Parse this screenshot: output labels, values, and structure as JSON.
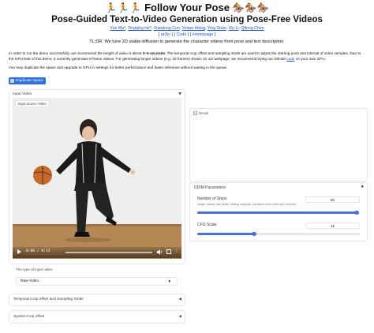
{
  "header": {
    "title_prefix_icons": "🏃🏃🏃",
    "title": "Follow Your Pose",
    "title_suffix_icons": "🏇🏇🏇",
    "subtitle": "Pose-Guided Text-to-Video Generation using Pose-Free Videos",
    "authors": [
      "Yue Ma*",
      "Yingqing He*",
      "Xiaodong Cun",
      "Xintao Wang",
      "Ying Shan",
      "Xiu Li",
      "Qifeng Chen"
    ],
    "links": {
      "open": "[ ",
      "arxiv": "arXiv",
      "sep1": " ] [ ",
      "code": "Code",
      "sep2": " ] [ ",
      "homepage": "Homepage",
      "close": " ]"
    },
    "tldr": "TL;DR: We tune 2D stable-diffusion to generate the character videos from pose and text description."
  },
  "notes": {
    "line1_a": "In order to run the demo successfully, we recommend the length of video is about ",
    "line1_b": "3~5 seconds",
    "line1_c": ". The temporal crop offset and sampling stride are used to adjust the starting point and interval of video samples. Due to",
    "line2_a": "the GPU limit of this demo, it currently generates 8-frame videos. For generating longer videos (e.g. 32 frames) shown on our webpage, we recommend trying our GitHub ",
    "line2_link": "code",
    "line2_b": " on your own GPU.",
    "line3": "You may duplicate the space and upgrade to GPU in settings for better performance and faster inference without waiting in the queue."
  },
  "duplicate_button": "Duplicate Space",
  "input_panel": {
    "title": "Input Video",
    "source_label": "Input Source Video",
    "time": "0:00 / 0:13",
    "type_label": "The type of input video",
    "type_value": "Raw Video",
    "accordions": [
      "Temporal Crop offset and Sampling Stride",
      "Spatial Crop offset"
    ]
  },
  "result_panel": {
    "title": "Result"
  },
  "ddim": {
    "title": "DDIM Parameters",
    "steps_label": "Number of Steps",
    "steps_info": "longer values has better editing capacity, but takes more time and memory",
    "steps_value": "50",
    "steps_fraction": 0.98,
    "cfg_label": "CFG Scale",
    "cfg_value": "12",
    "cfg_fraction": 0.35
  },
  "colors": {
    "accent": "#4a71dd",
    "link": "#1a56db",
    "button": "#2f6fdf"
  },
  "icons": [
    "video-icon",
    "image-icon",
    "play-icon",
    "volume-icon",
    "fullscreen-icon",
    "more-icon",
    "caret-down-icon",
    "caret-left-icon"
  ]
}
